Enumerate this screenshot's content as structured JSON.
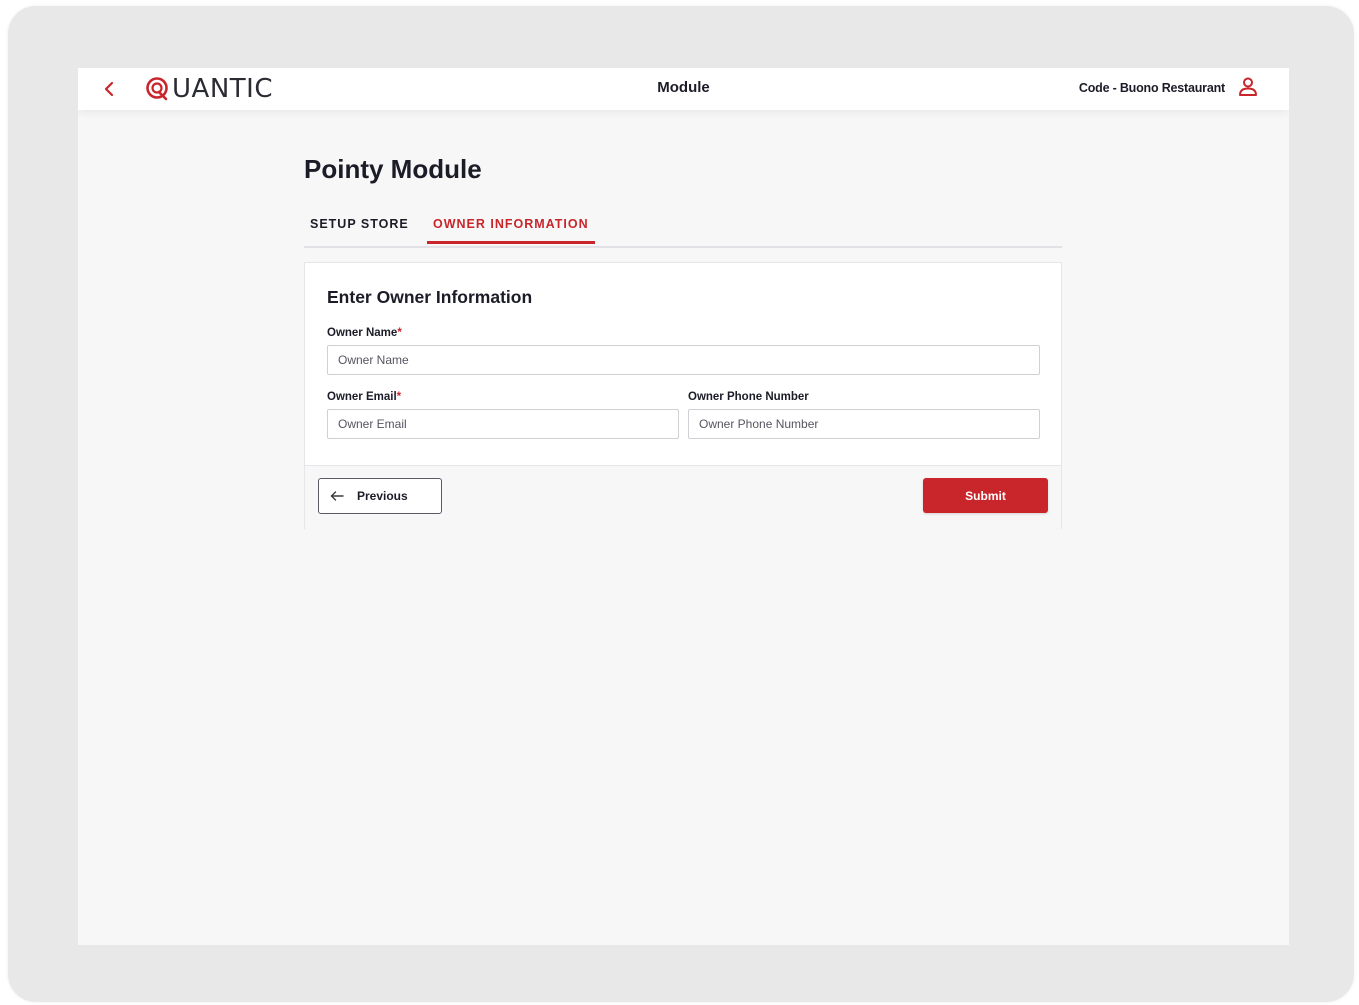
{
  "colors": {
    "accent": "#c8262b",
    "text": "#1c1c28",
    "background": "#f7f7f8"
  },
  "header": {
    "back_icon": "chevron-left-icon",
    "logo_text": "UANTIC",
    "logo_icon": "quantic-q-logo",
    "title": "Module",
    "user_label": "Code - Buono Restaurant",
    "user_icon": "user-icon"
  },
  "page": {
    "title": "Pointy Module"
  },
  "tabs": [
    {
      "label": "SETUP STORE",
      "active": false
    },
    {
      "label": "OWNER INFORMATION",
      "active": true
    }
  ],
  "form": {
    "title": "Enter Owner Information",
    "required_marker": "*",
    "fields": {
      "owner_name": {
        "label": "Owner Name",
        "required": true,
        "placeholder": "Owner Name",
        "value": ""
      },
      "owner_email": {
        "label": "Owner Email",
        "required": true,
        "placeholder": "Owner Email",
        "value": ""
      },
      "owner_phone": {
        "label": "Owner Phone Number",
        "required": false,
        "placeholder": "Owner Phone Number",
        "value": ""
      }
    },
    "previous_label": "Previous",
    "previous_icon": "arrow-left-icon",
    "submit_label": "Submit"
  }
}
